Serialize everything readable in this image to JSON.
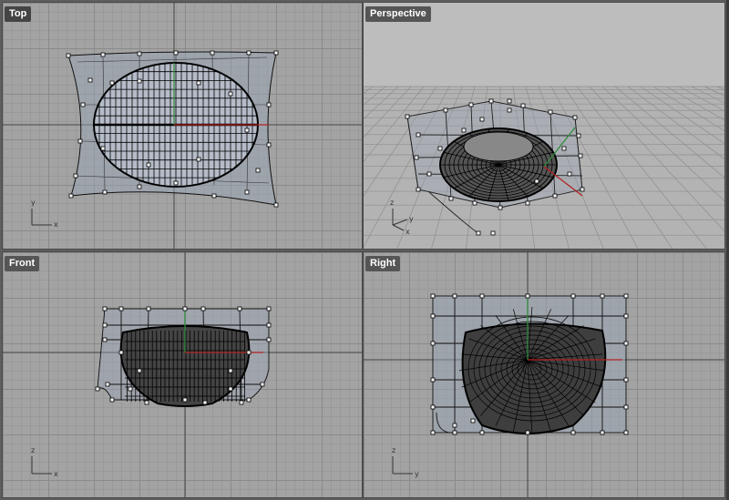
{
  "viewports": [
    {
      "id": "top",
      "title": "Top",
      "axes": [
        "y",
        "x"
      ]
    },
    {
      "id": "perspective",
      "title": "Perspective",
      "axes": [
        "z",
        "y",
        "x"
      ]
    },
    {
      "id": "front",
      "title": "Front",
      "axes": [
        "z",
        "x"
      ]
    },
    {
      "id": "right",
      "title": "Right",
      "axes": [
        "z",
        "y"
      ]
    }
  ],
  "colors": {
    "grid_bg": "#a3a3a3",
    "x_axis": "#b22222",
    "y_axis": "#2e8b3a",
    "wire": "#000000",
    "control_net": "#1a1a1a",
    "surface_tint": "#9aa6b8"
  },
  "icons": {
    "axis_widget": "cplane-axes-icon"
  }
}
